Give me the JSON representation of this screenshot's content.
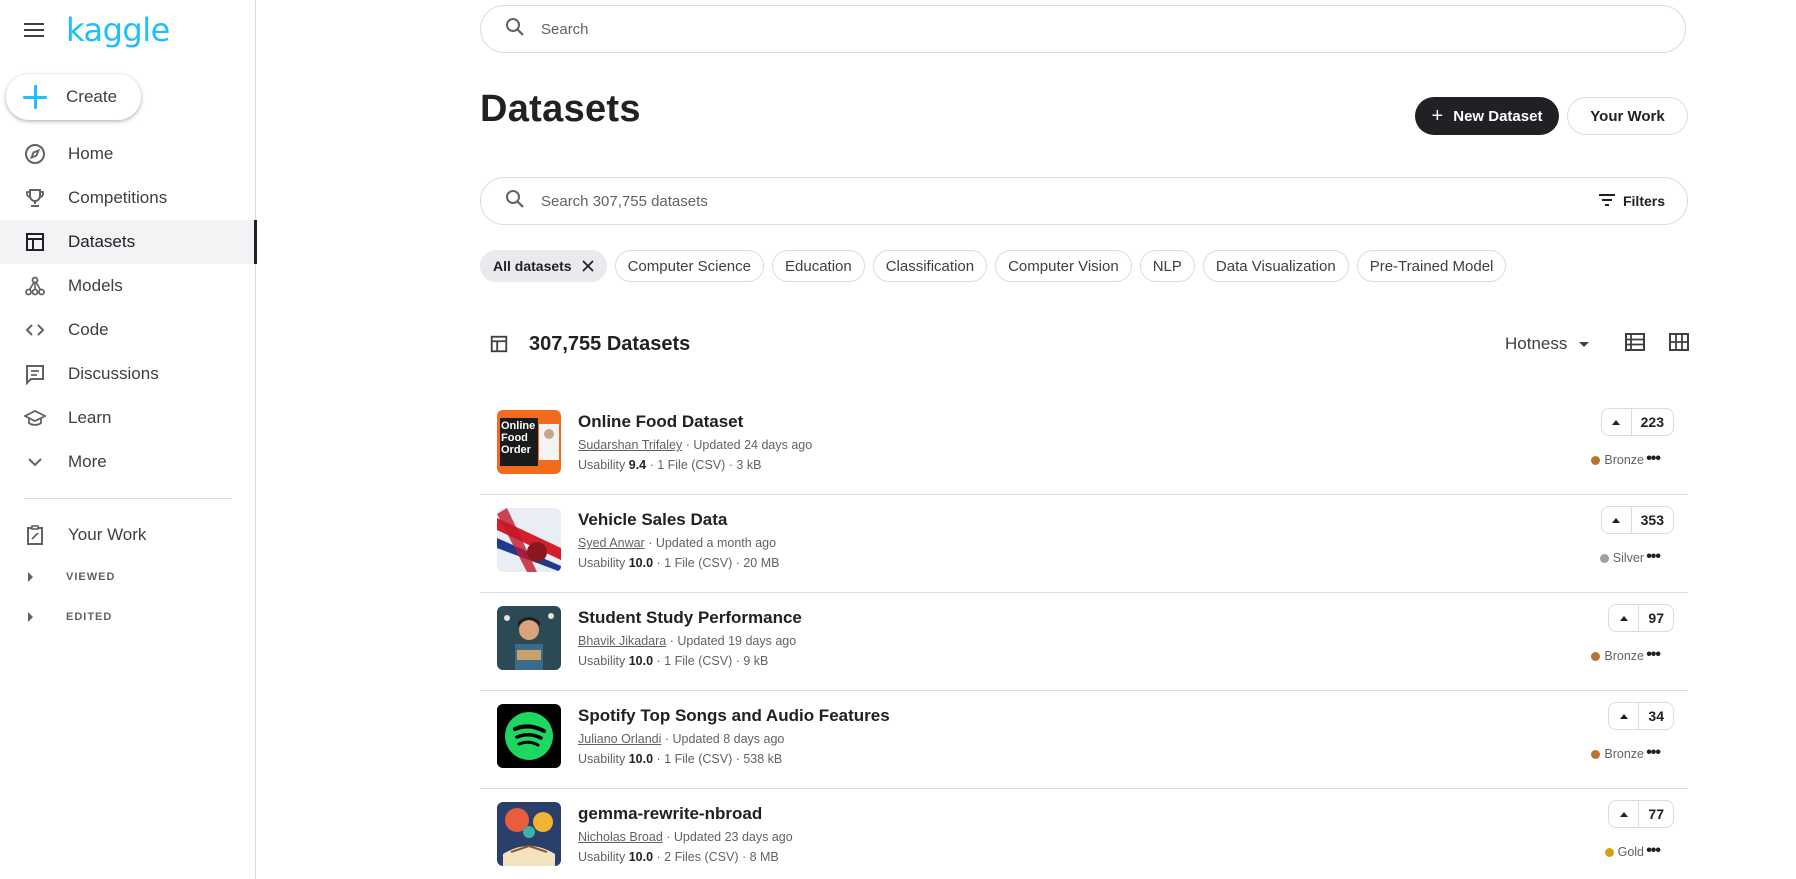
{
  "brand": {
    "logo_text": "kaggle",
    "accent": "#20beff"
  },
  "sidebar": {
    "create_label": "Create",
    "items": [
      {
        "label": "Home",
        "icon": "compass-icon"
      },
      {
        "label": "Competitions",
        "icon": "trophy-icon"
      },
      {
        "label": "Datasets",
        "icon": "table-icon",
        "active": true
      },
      {
        "label": "Models",
        "icon": "models-icon"
      },
      {
        "label": "Code",
        "icon": "code-icon"
      },
      {
        "label": "Discussions",
        "icon": "comments-icon"
      },
      {
        "label": "Learn",
        "icon": "school-icon"
      },
      {
        "label": "More",
        "icon": "chevron-down-icon"
      }
    ],
    "your_work": "Your Work",
    "viewed": "VIEWED",
    "edited": "EDITED"
  },
  "search": {
    "placeholder": "Search"
  },
  "header": {
    "title": "Datasets",
    "new_dataset": "New Dataset",
    "your_work": "Your Work"
  },
  "dataset_search": {
    "placeholder": "Search 307,755 datasets",
    "filters": "Filters"
  },
  "chips": [
    "All datasets",
    "Computer Science",
    "Education",
    "Classification",
    "Computer Vision",
    "NLP",
    "Data Visualization",
    "Pre-Trained Model"
  ],
  "list": {
    "count": "307,755 Datasets",
    "sort": "Hotness"
  },
  "datasets": [
    {
      "title": "Online Food Dataset",
      "author": "Sudarshan Trifaley",
      "updated": " · Updated 24 days ago",
      "usability_label": "Usability ",
      "usability": "9.4",
      "files": " · 1 File (CSV) · 3 kB",
      "votes": "223",
      "medal": "Bronze",
      "medal_color": "#b87333",
      "thumb_text": "Online Food Order"
    },
    {
      "title": "Vehicle Sales Data",
      "author": "Syed Anwar",
      "updated": " · Updated a month ago",
      "usability_label": "Usability ",
      "usability": "10.0",
      "files": " · 1 File (CSV) · 20 MB",
      "votes": "353",
      "medal": "Silver",
      "medal_color": "#9aa0a6"
    },
    {
      "title": "Student Study Performance",
      "author": "Bhavik Jikadara",
      "updated": " · Updated 19 days ago",
      "usability_label": "Usability ",
      "usability": "10.0",
      "files": " · 1 File (CSV) · 9 kB",
      "votes": "97",
      "medal": "Bronze",
      "medal_color": "#b87333"
    },
    {
      "title": "Spotify Top Songs and Audio Features",
      "author": "Juliano Orlandi",
      "updated": " · Updated 8 days ago",
      "usability_label": "Usability ",
      "usability": "10.0",
      "files": " · 1 File (CSV) · 538 kB",
      "votes": "34",
      "medal": "Bronze",
      "medal_color": "#b87333"
    },
    {
      "title": "gemma-rewrite-nbroad",
      "author": "Nicholas Broad",
      "updated": " · Updated 23 days ago",
      "usability_label": "Usability ",
      "usability": "10.0",
      "files": " · 2 Files (CSV) · 8 MB",
      "votes": "77",
      "medal": "Gold",
      "medal_color": "#d4a017"
    }
  ]
}
